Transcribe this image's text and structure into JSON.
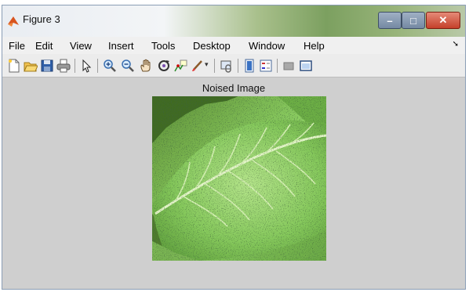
{
  "window": {
    "title": "Figure 3"
  },
  "menu": [
    "File",
    "Edit",
    "View",
    "Insert",
    "Tools",
    "Desktop",
    "Window",
    "Help"
  ],
  "toolbar": [
    {
      "name": "new-figure-icon"
    },
    {
      "name": "open-file-icon"
    },
    {
      "name": "save-icon"
    },
    {
      "name": "print-icon"
    },
    {
      "name": "edit-plot-arrow-icon"
    },
    {
      "name": "zoom-in-icon"
    },
    {
      "name": "zoom-out-icon"
    },
    {
      "name": "pan-hand-icon"
    },
    {
      "name": "rotate-3d-icon"
    },
    {
      "name": "data-cursor-icon"
    },
    {
      "name": "brush-icon"
    },
    {
      "name": "link-plot-icon"
    },
    {
      "name": "insert-colorbar-icon"
    },
    {
      "name": "insert-legend-icon"
    },
    {
      "name": "hide-plot-tools-icon"
    },
    {
      "name": "show-plot-tools-icon"
    }
  ],
  "figure": {
    "axes_title": "Noised Image",
    "image_subject": "leaf"
  },
  "colors": {
    "figure_bg": "#cfcfcf",
    "leaf_green": "#7cbc55"
  }
}
